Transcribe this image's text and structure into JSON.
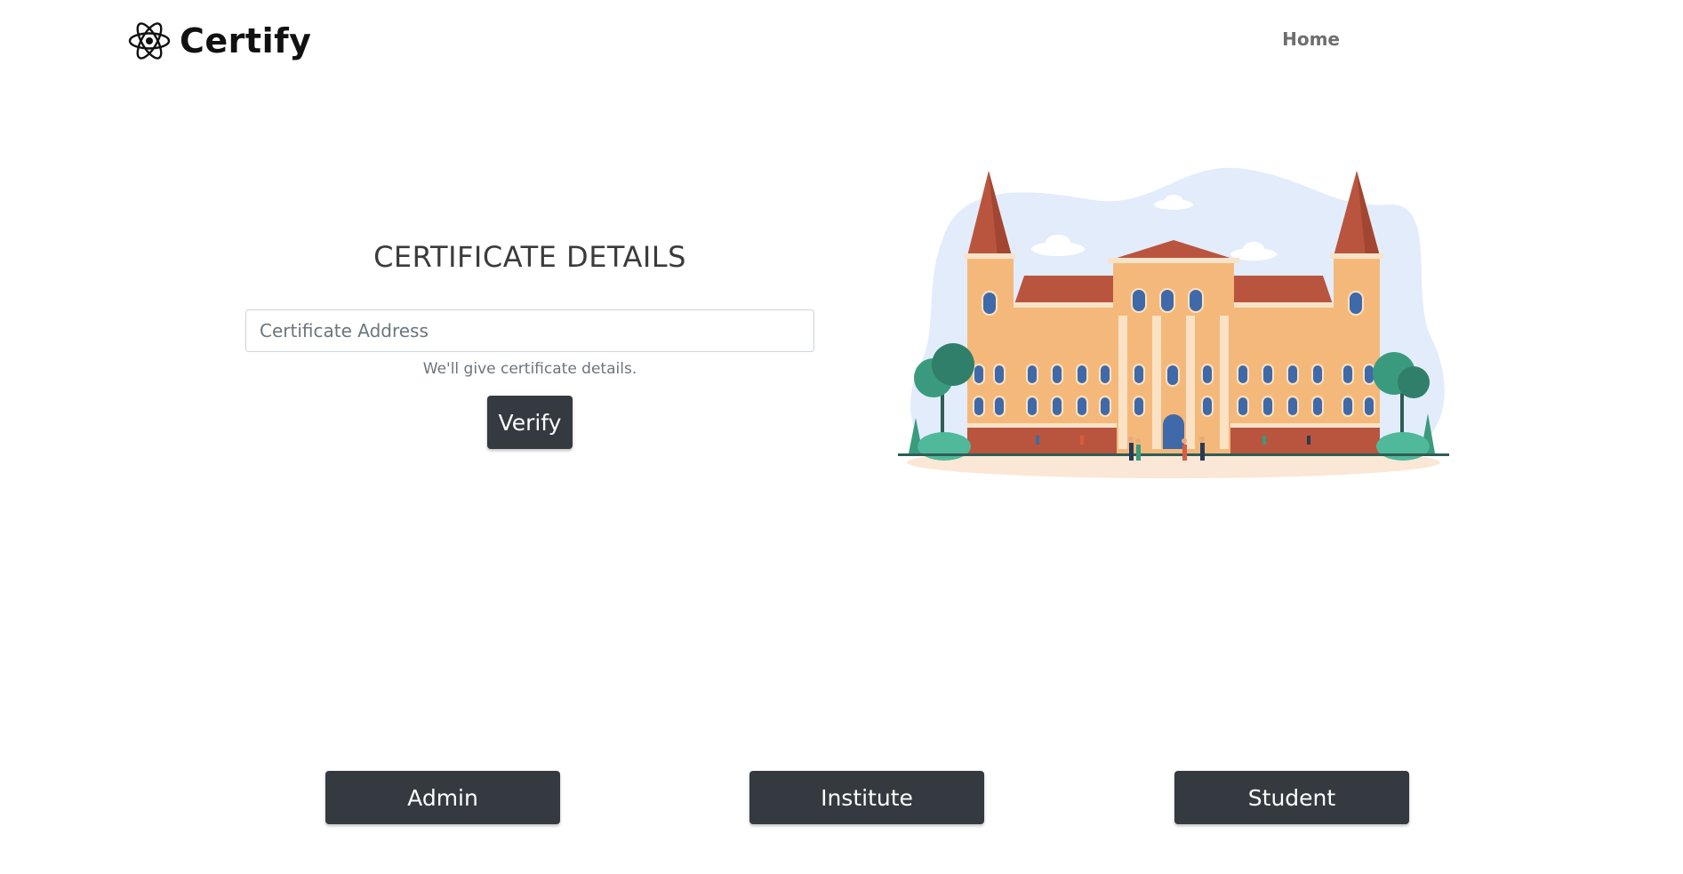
{
  "navbar": {
    "brand_name": "Certify",
    "brand_icon": "atom-icon",
    "home_link": "Home"
  },
  "certificate_form": {
    "title": "CERTIFICATE DETAILS",
    "input_placeholder": "Certificate Address",
    "input_value": "",
    "help_text": "We'll give certificate details.",
    "verify_label": "Verify"
  },
  "illustration": {
    "icon": "university-building-illustration"
  },
  "roles": {
    "admin_label": "Admin",
    "institute_label": "Institute",
    "student_label": "Student"
  },
  "colors": {
    "button_dark": "#343a40",
    "building_orange": "#f4b97a",
    "roof_red": "#b9553f",
    "sky_blue": "#e3ecfb",
    "tree_green": "#3a9a7d"
  }
}
